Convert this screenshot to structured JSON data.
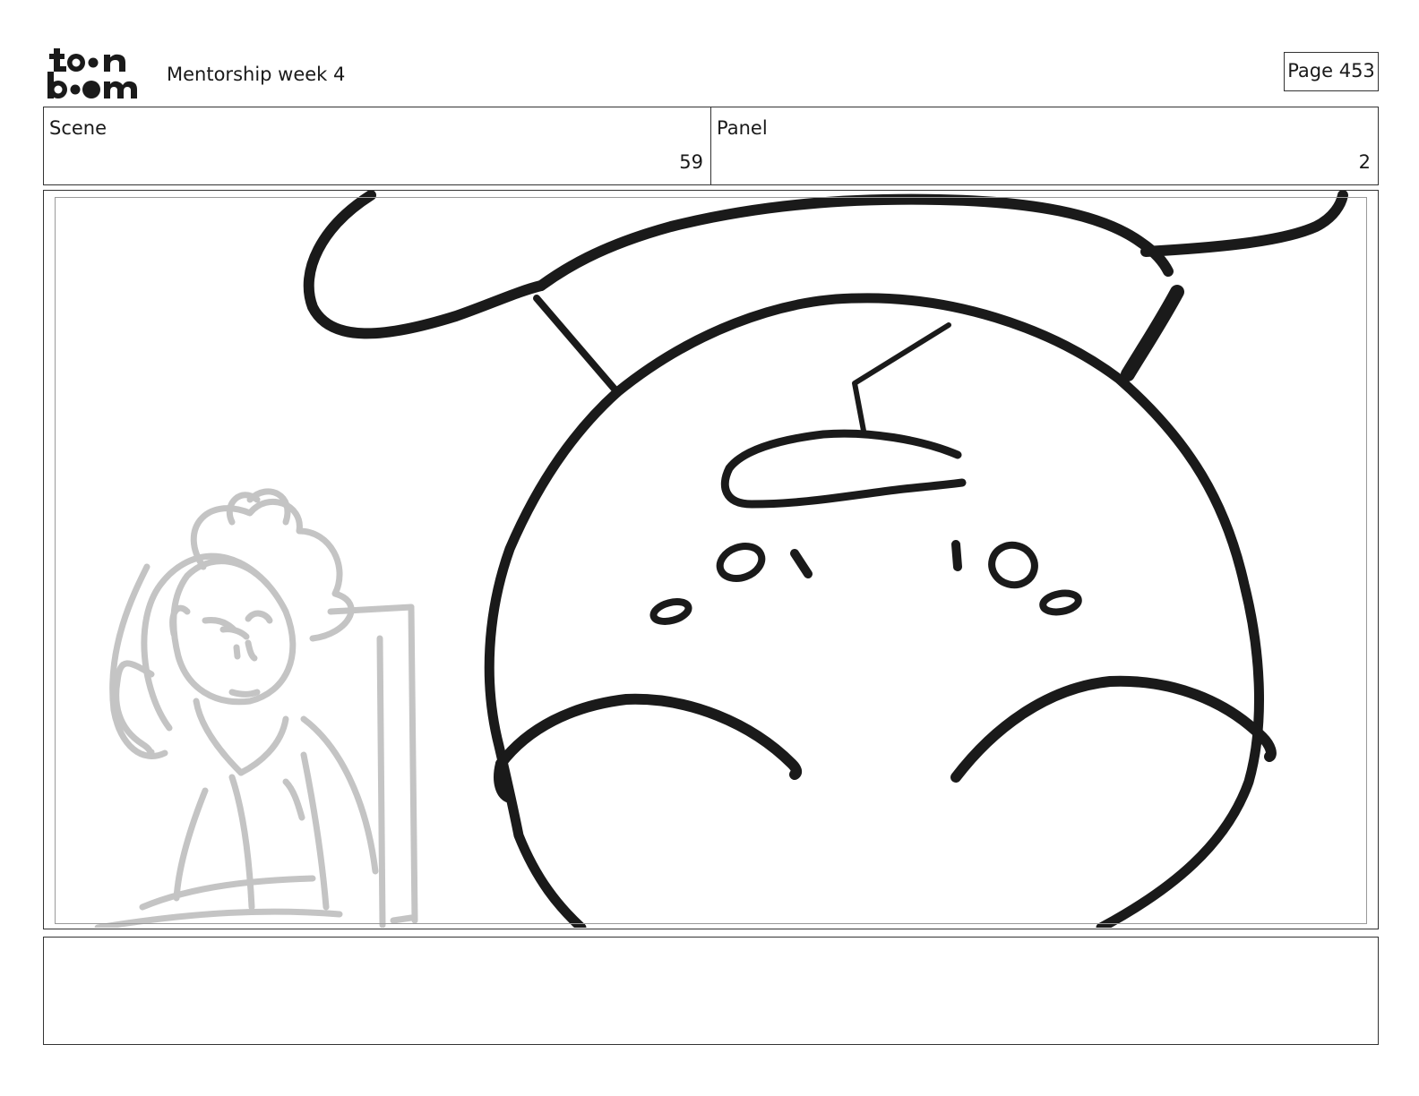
{
  "header": {
    "logo_text": "toon boom",
    "title": "Mentorship week 4",
    "page_label": "Page 453"
  },
  "info": {
    "scene_label": "Scene",
    "scene_value": "59",
    "panel_label": "Panel",
    "panel_value": "2"
  },
  "notes": {
    "text": ""
  },
  "colors": {
    "ink": "#1a1a1a",
    "sketch": "#c4c4c4",
    "frame": "#333333",
    "safe_area": "#9a9a9a"
  }
}
